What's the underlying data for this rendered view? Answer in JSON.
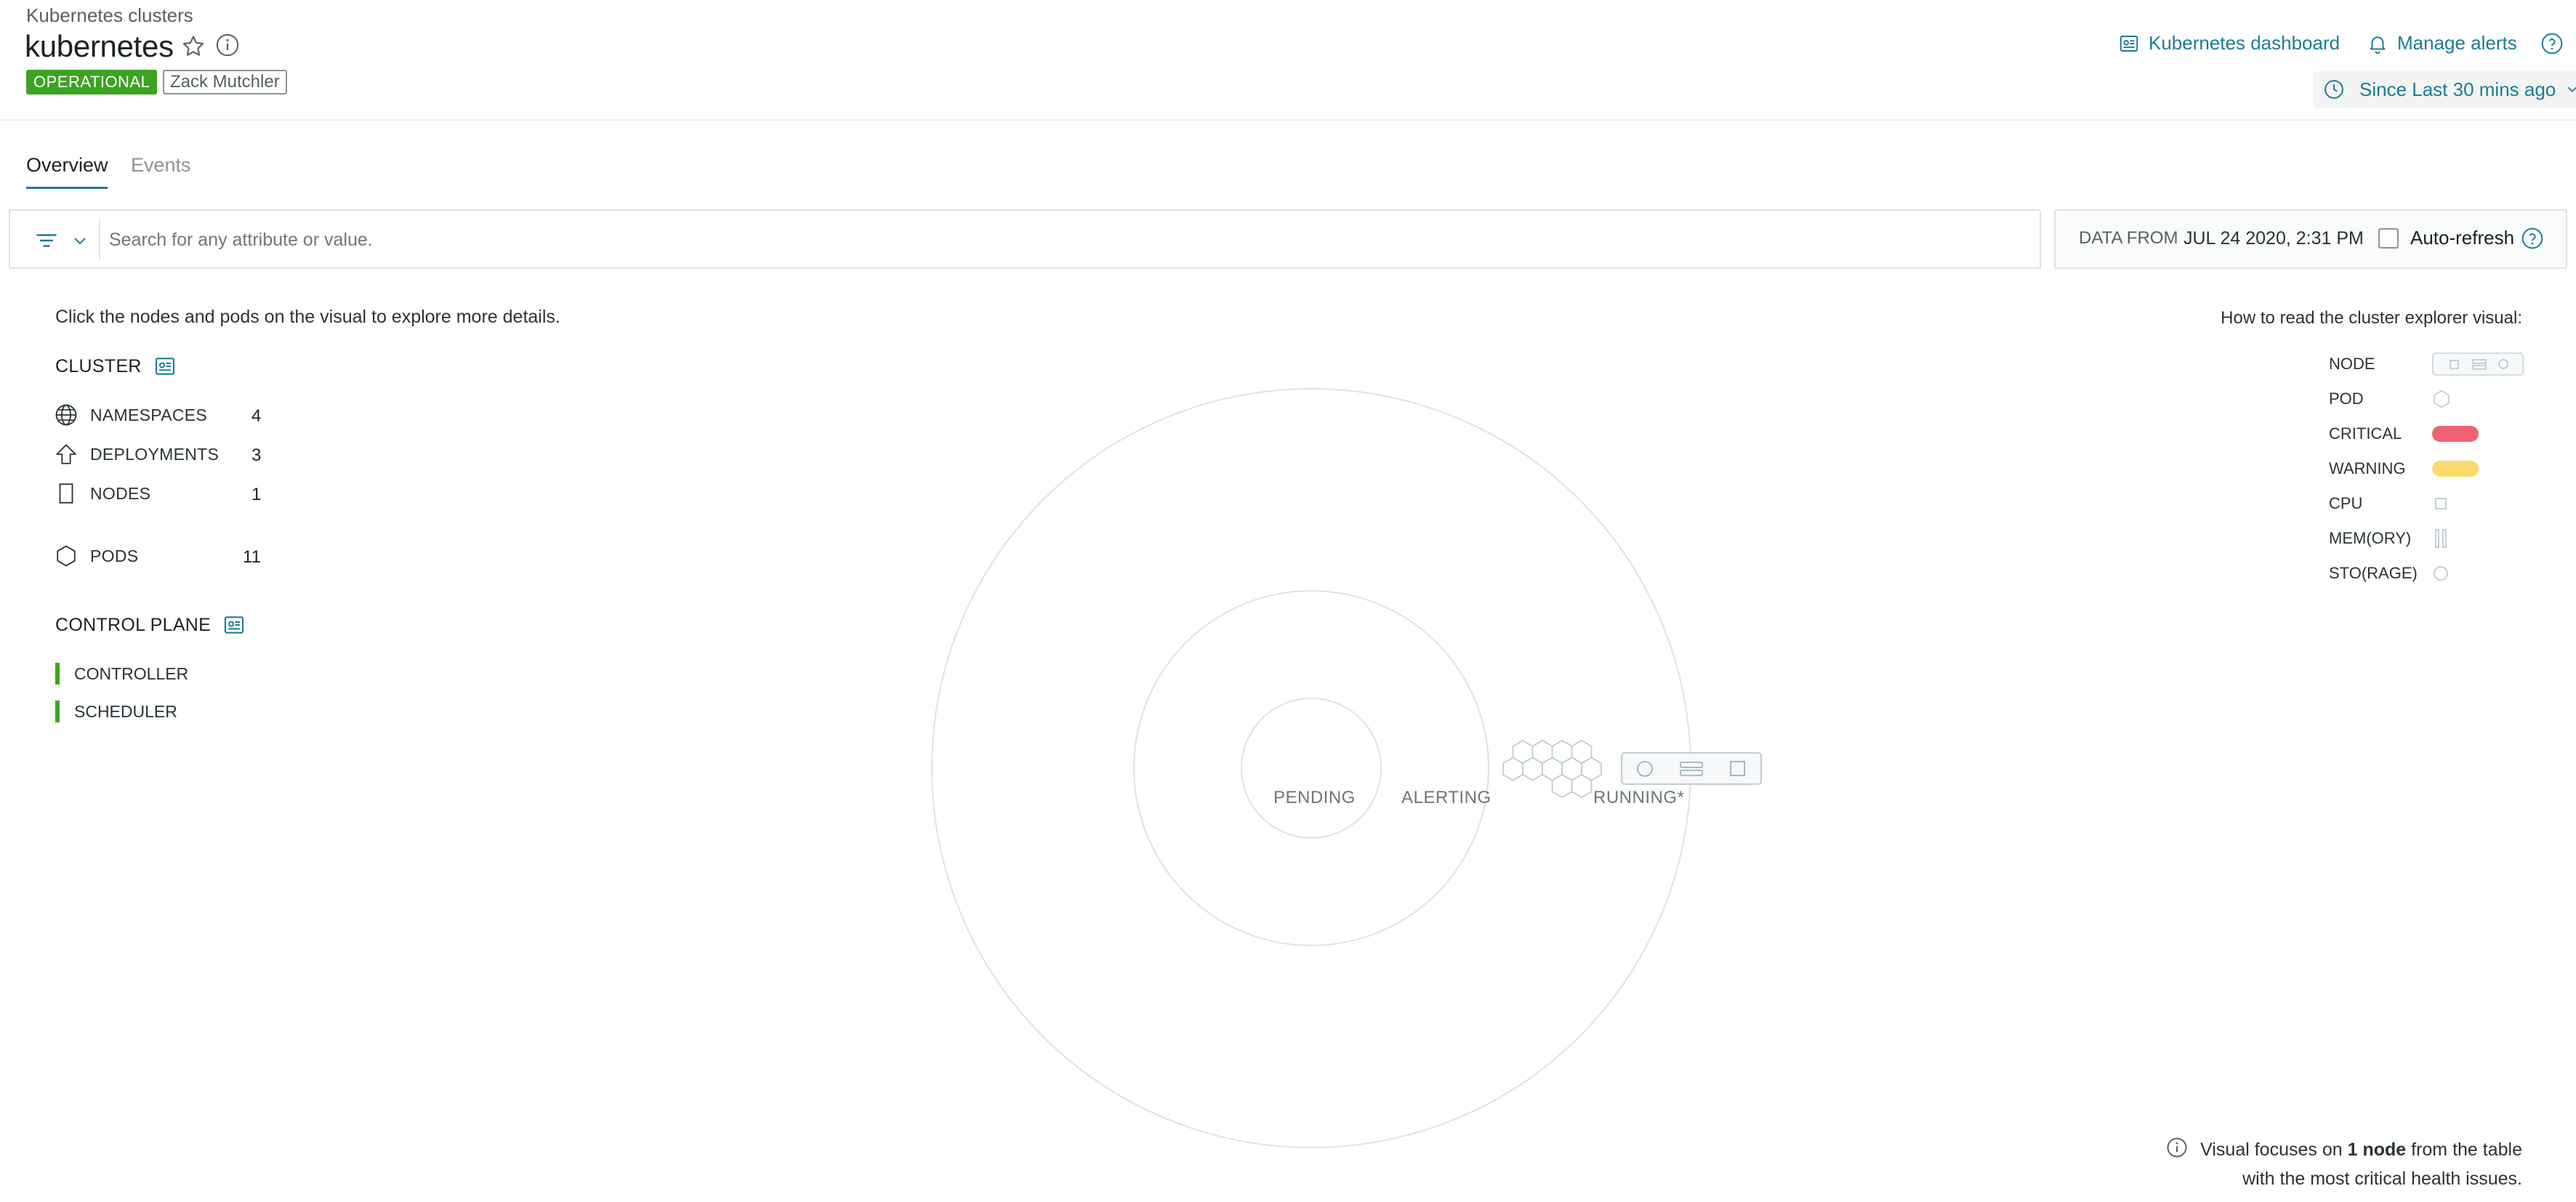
{
  "header": {
    "breadcrumb": "Kubernetes clusters",
    "title": "kubernetes",
    "status_badge": "OPERATIONAL",
    "owner_tag": "Zack Mutchler",
    "dashboard_link": "Kubernetes dashboard",
    "alerts_link": "Manage alerts",
    "time_picker": "Since Last 30 mins ago"
  },
  "tabs": [
    {
      "label": "Overview",
      "active": true
    },
    {
      "label": "Events",
      "active": false
    }
  ],
  "search": {
    "placeholder": "Search for any attribute or value."
  },
  "data_from": {
    "label": "DATA FROM",
    "value": "JUL 24 2020, 2:31 PM",
    "auto_refresh": "Auto-refresh"
  },
  "intro": "Click the nodes and pods on the visual to explore more details.",
  "cluster": {
    "heading": "CLUSTER",
    "stats": [
      {
        "icon": "globe-icon",
        "label": "NAMESPACES",
        "value": "4"
      },
      {
        "icon": "deployment-arrow-icon",
        "label": "DEPLOYMENTS",
        "value": "3"
      },
      {
        "icon": "node-square-icon",
        "label": "NODES",
        "value": "1"
      },
      {
        "icon": "pod-hexagon-icon",
        "label": "PODS",
        "value": "11"
      }
    ]
  },
  "control_plane": {
    "heading": "CONTROL PLANE",
    "items": [
      {
        "label": "CONTROLLER",
        "color": "#3ca321"
      },
      {
        "label": "SCHEDULER",
        "color": "#3ca321"
      }
    ]
  },
  "visual": {
    "ring_labels": [
      "PENDING",
      "ALERTING",
      "RUNNING*"
    ]
  },
  "legend": {
    "title": "How to read the cluster explorer visual:",
    "items": [
      {
        "label": "NODE"
      },
      {
        "label": "POD"
      },
      {
        "label": "CRITICAL",
        "color": "#ef6275"
      },
      {
        "label": "WARNING",
        "color": "#fcd96b"
      },
      {
        "label": "CPU"
      },
      {
        "label": "MEM(ORY)"
      },
      {
        "label": "STO(RAGE)"
      }
    ]
  },
  "footnote": {
    "prefix": "Visual focuses on ",
    "bold": "1 node",
    "suffix": " from the table",
    "line2": "with the most critical health issues."
  },
  "colors": {
    "accent": "#1d7b96",
    "operational": "#3ca321",
    "critical": "#ef6275",
    "warning": "#fcd96b"
  }
}
